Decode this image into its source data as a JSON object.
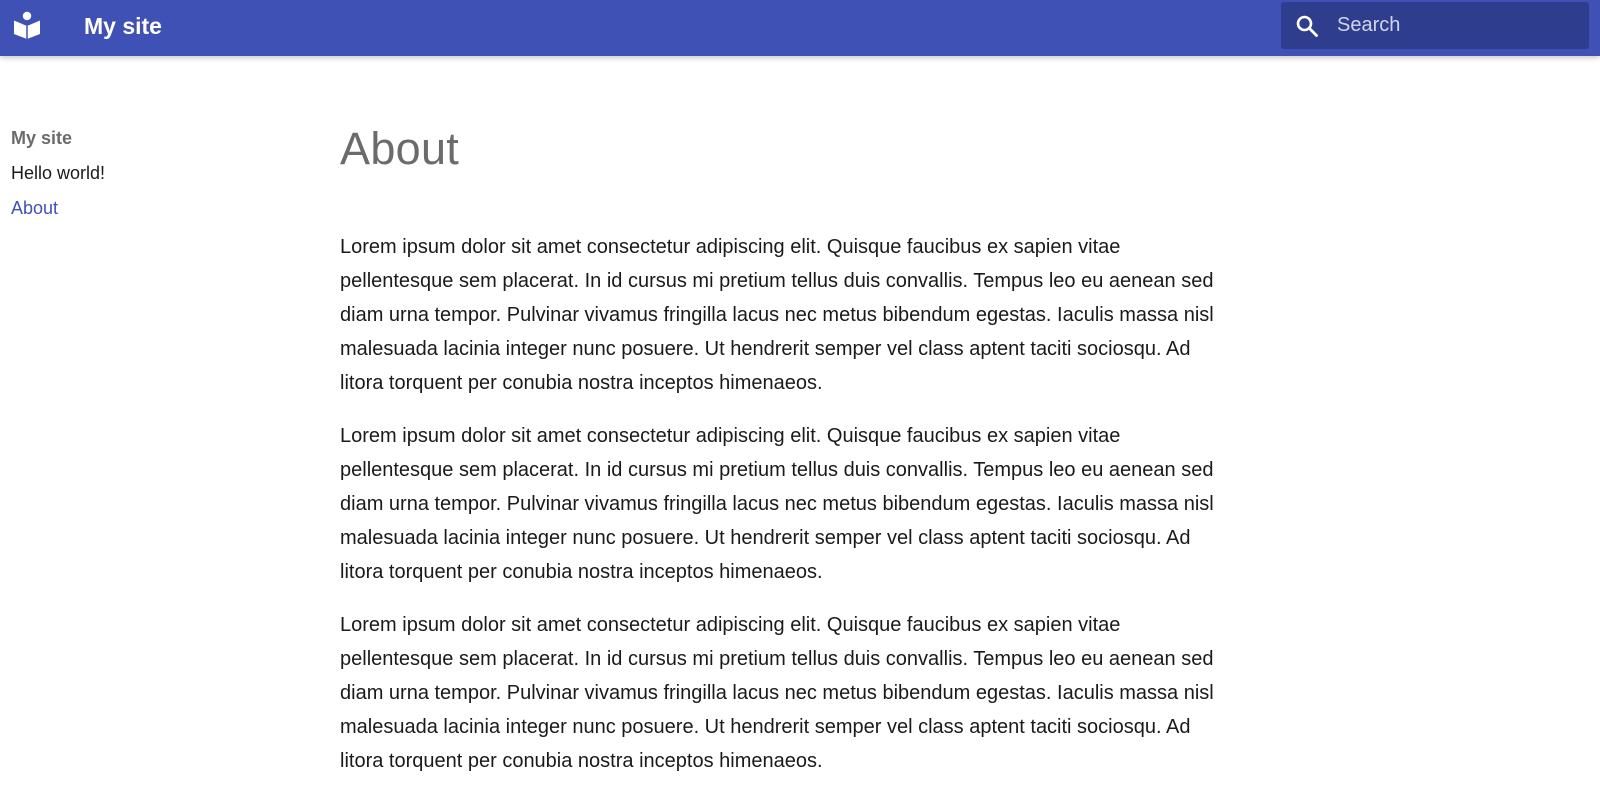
{
  "header": {
    "logo_icon": "book-reader-icon",
    "site_title": "My site",
    "search": {
      "icon": "search-icon",
      "placeholder": "Search",
      "value": ""
    },
    "background_color": "#3f51b5"
  },
  "sidebar": {
    "title": "My site",
    "items": [
      {
        "label": "Hello world!",
        "active": false
      },
      {
        "label": "About",
        "active": true
      }
    ],
    "active_color": "#3f51b5"
  },
  "main": {
    "title": "About",
    "paragraphs": [
      "Lorem ipsum dolor sit amet consectetur adipiscing elit. Quisque faucibus ex sapien vitae pellentesque sem placerat. In id cursus mi pretium tellus duis convallis. Tempus leo eu aenean sed diam urna tempor. Pulvinar vivamus fringilla lacus nec metus bibendum egestas. Iaculis massa nisl malesuada lacinia integer nunc posuere. Ut hendrerit semper vel class aptent taciti sociosqu. Ad litora torquent per conubia nostra inceptos himenaeos.",
      "Lorem ipsum dolor sit amet consectetur adipiscing elit. Quisque faucibus ex sapien vitae pellentesque sem placerat. In id cursus mi pretium tellus duis convallis. Tempus leo eu aenean sed diam urna tempor. Pulvinar vivamus fringilla lacus nec metus bibendum egestas. Iaculis massa nisl malesuada lacinia integer nunc posuere. Ut hendrerit semper vel class aptent taciti sociosqu. Ad litora torquent per conubia nostra inceptos himenaeos.",
      "Lorem ipsum dolor sit amet consectetur adipiscing elit. Quisque faucibus ex sapien vitae pellentesque sem placerat. In id cursus mi pretium tellus duis convallis. Tempus leo eu aenean sed diam urna tempor. Pulvinar vivamus fringilla lacus nec metus bibendum egestas. Iaculis massa nisl malesuada lacinia integer nunc posuere. Ut hendrerit semper vel class aptent taciti sociosqu. Ad litora torquent per conubia nostra inceptos himenaeos."
    ]
  }
}
